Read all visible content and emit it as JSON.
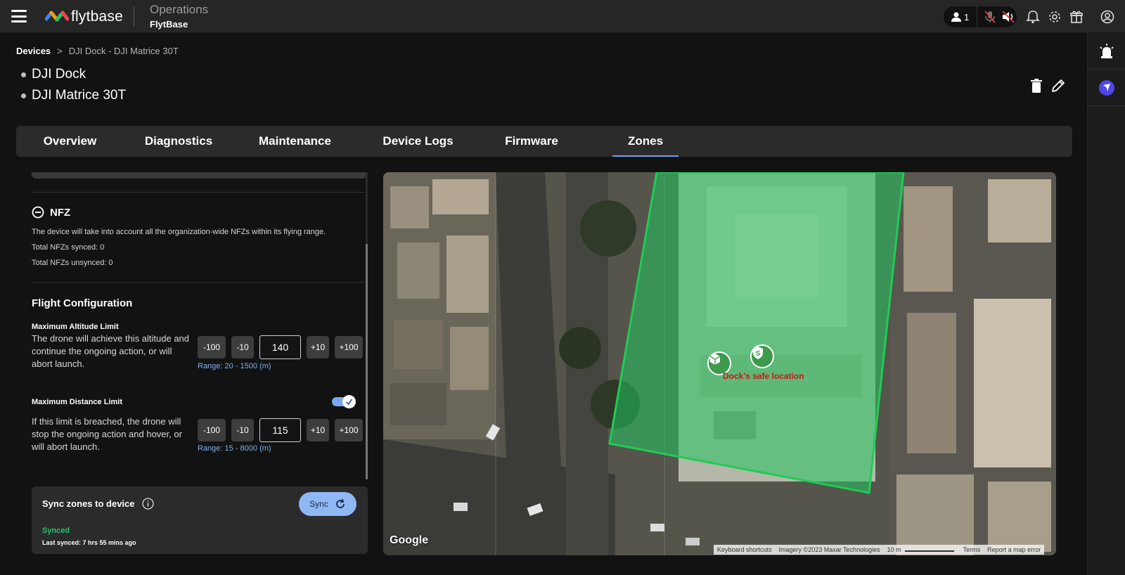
{
  "header": {
    "logo_text": "flytbase",
    "app_title": "Operations",
    "org_name": "FlytBase",
    "users_count": "1"
  },
  "breadcrumb": {
    "root": "Devices",
    "separator": ">",
    "current": "DJI Dock - DJI Matrice 30T"
  },
  "devices": [
    "DJI Dock",
    "DJI Matrice 30T"
  ],
  "tabs": [
    "Overview",
    "Diagnostics",
    "Maintenance",
    "Device Logs",
    "Firmware",
    "Zones"
  ],
  "active_tab": "Zones",
  "nfz": {
    "title": "NFZ",
    "description": "The device will take into account all the organization-wide NFZs within its flying range.",
    "synced": "Total NFZs synced: 0",
    "unsynced": "Total NFZs unsynced: 0"
  },
  "flight_config": {
    "title": "Flight Configuration",
    "altitude": {
      "label": "Maximum Altitude Limit",
      "description": "The drone will achieve this altitude and continue the ongoing action, or will abort launch.",
      "buttons": [
        "-100",
        "-10",
        "+10",
        "+100"
      ],
      "value": "140",
      "range": "Range: 20 - 1500 (m)"
    },
    "distance": {
      "label": "Maximum Distance Limit",
      "enabled": true,
      "description": "If this limit is breached, the drone will stop the ongoing action and hover, or will abort launch.",
      "buttons": [
        "-100",
        "-10",
        "+10",
        "+100"
      ],
      "value": "115",
      "range": "Range: 15 - 8000 (m)"
    }
  },
  "sync": {
    "title": "Sync zones to device",
    "button": "Sync",
    "status": "Synced",
    "last_synced": "Last synced: 7 hrs 55 mins ago"
  },
  "map": {
    "safe_location_label": "Dock's safe location",
    "provider": "Google",
    "attribution": [
      "Keyboard shortcuts",
      "Imagery ©2023 Maxar Technologies",
      "10 m",
      "Terms",
      "Report a map error"
    ],
    "zone_color": "#22c55e"
  },
  "colors": {
    "accent": "#6aa2f7",
    "synced": "#27c26a",
    "safe_label": "#c21b1b"
  }
}
